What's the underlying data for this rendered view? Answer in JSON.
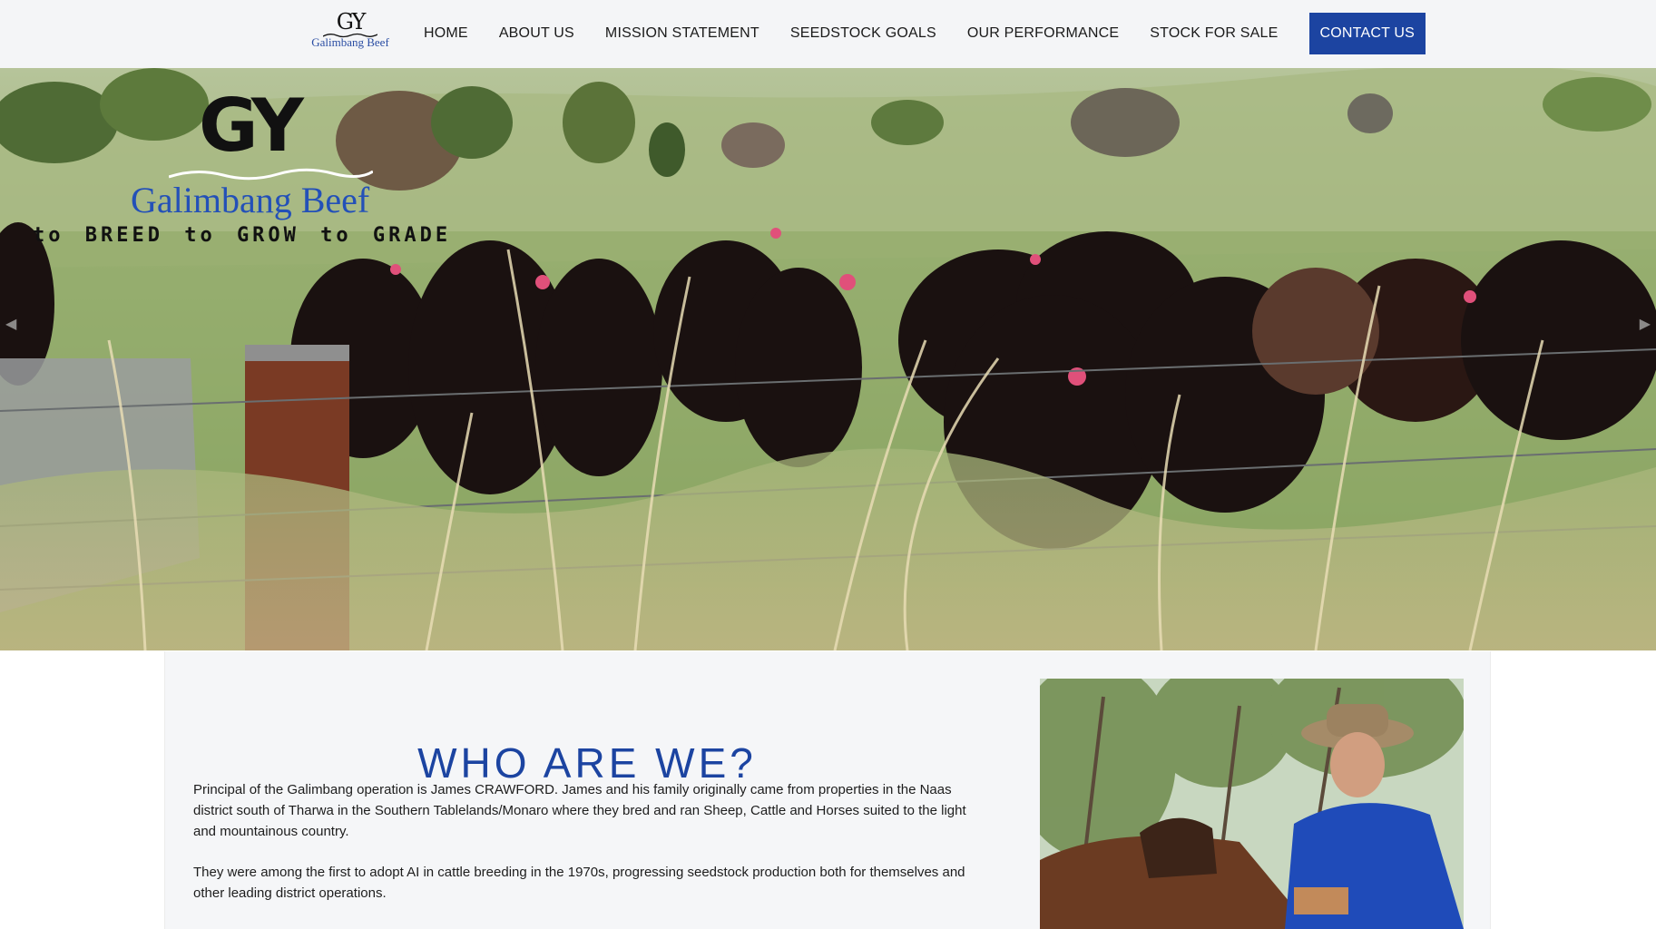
{
  "header": {
    "logo": {
      "monogram": "GY",
      "name": "Galimbang Beef"
    },
    "nav": [
      {
        "label": "HOME"
      },
      {
        "label": "ABOUT US"
      },
      {
        "label": "MISSION STATEMENT"
      },
      {
        "label": "SEEDSTOCK GOALS"
      },
      {
        "label": "OUR PERFORMANCE"
      },
      {
        "label": "STOCK FOR SALE"
      }
    ],
    "cta_label": "CONTACT US"
  },
  "hero": {
    "brand_monogram": "GY",
    "brand_name": "Galimbang Beef",
    "tagline": "to BREED  to GROW  to GRADE",
    "prev_arrow": "◀",
    "next_arrow": "▶"
  },
  "about": {
    "title": "WHO ARE WE?",
    "paragraphs": [
      "Principal of the Galimbang operation is James CRAWFORD. James and his family originally came from properties in the Naas district south of Tharwa in the Southern Tablelands/Monaro where they bred and ran Sheep, Cattle and Horses suited to the light and mountainous country.",
      "They were among the first to adopt AI in cattle breeding in the 1970s, progressing seedstock production both for themselves and other leading district operations."
    ]
  },
  "colors": {
    "brand_blue": "#1c44a1",
    "header_bg": "#f4f5f7",
    "section_bg": "#f5f6f8"
  }
}
